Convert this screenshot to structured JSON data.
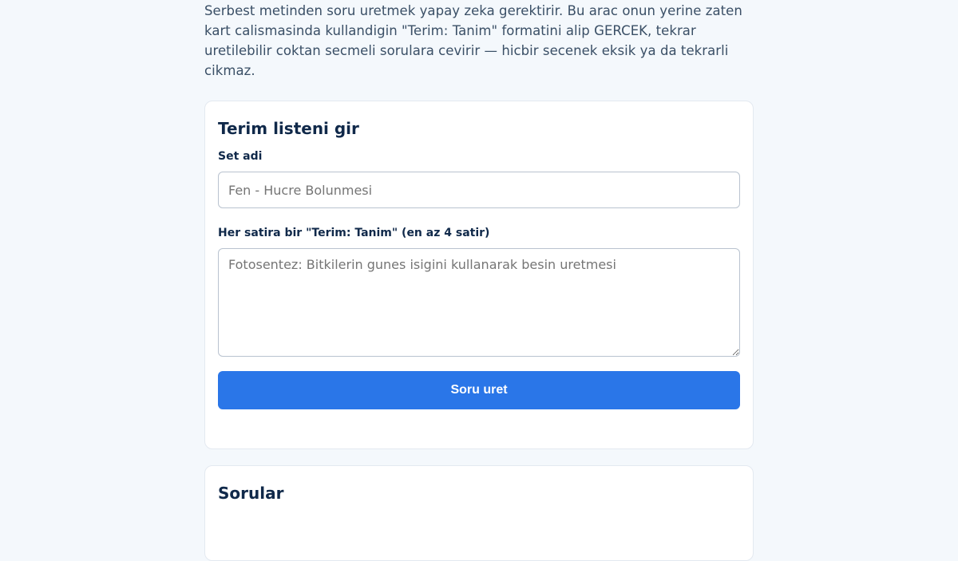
{
  "intro": {
    "text": "Serbest metinden soru uretmek yapay zeka gerektirir. Bu arac onun yerine zaten kart calismasinda kullandigin \"Terim: Tanim\" formatini alip GERCEK, tekrar uretilebilir coktan secmeli sorulara cevirir — hicbir secenek eksik ya da tekrarli cikmaz."
  },
  "input_card": {
    "title": "Terim listeni gir",
    "set_name_label": "Set adi",
    "set_name_placeholder": "Fen - Hucre Bolunmesi",
    "set_name_value": "",
    "terms_label": "Her satira bir \"Terim: Tanim\" (en az 4 satir)",
    "terms_placeholder": "Fotosentez: Bitkilerin gunes isigini kullanarak besin uretmesi",
    "terms_value": "",
    "submit_label": "Soru uret"
  },
  "results_card": {
    "title": "Sorular"
  },
  "colors": {
    "background": "#f4f8fc",
    "accent": "#2a76e8",
    "heading": "#10294a"
  }
}
